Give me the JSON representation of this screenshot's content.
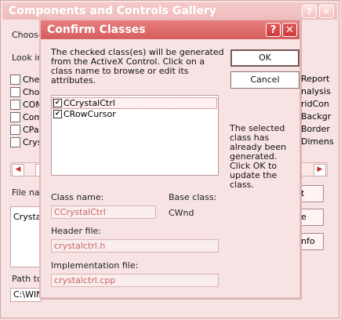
{
  "main_window": {
    "title": "Components and Controls Gallery",
    "choose_label": "Choose",
    "look_in_label": "Look in",
    "file_name_label": "File nam",
    "file_value": "Crystal",
    "path_label": "Path to",
    "path_value": "C:\\WIN",
    "left_items": [
      "Che",
      "Cho",
      "COM",
      "Com",
      "CPa",
      "Crys"
    ],
    "right_items": [
      "Report",
      "nalysis",
      "ridCon",
      "Backgr",
      "Border",
      "Dimens"
    ],
    "btn_right_1": "t",
    "btn_right_2": "e",
    "btn_right_3": "nfo",
    "help_glyph": "?",
    "close_glyph": "✕",
    "scroll_left": "◀",
    "scroll_right": "▶"
  },
  "dialog": {
    "title": "Confirm Classes",
    "help_glyph": "?",
    "close_glyph": "✕",
    "description": "The checked class(es) will be generated from the ActiveX Control.  Click on a class name to browse or edit its attributes.",
    "ok_label": "OK",
    "cancel_label": "Cancel",
    "classes": [
      {
        "name": "CCrystalCtrl",
        "checked": true,
        "selected": true
      },
      {
        "name": "CRowCursor",
        "checked": true,
        "selected": false
      }
    ],
    "note": "The selected class has already been generated. Click OK to update the class.",
    "class_name_label": "Class name:",
    "class_name_value": "CCrystalCtrl",
    "base_class_label": "Base class:",
    "base_class_value": "CWnd",
    "header_file_label": "Header file:",
    "header_file_value": "crystalctrl.h",
    "impl_file_label": "Implementation file:",
    "impl_file_value": "crystalctrl.cpp",
    "check_glyph": "✔"
  }
}
